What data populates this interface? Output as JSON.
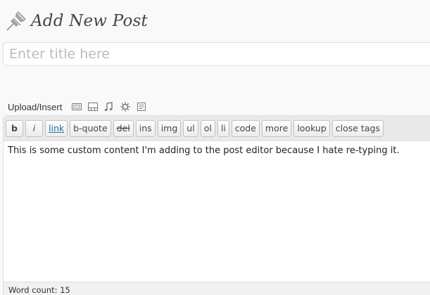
{
  "header": {
    "icon": "pushpin-icon",
    "title": "Add New Post"
  },
  "title_field": {
    "placeholder": "Enter title here",
    "value": ""
  },
  "media": {
    "label": "Upload/Insert",
    "icons": [
      "image-icon",
      "video-icon",
      "audio-icon",
      "media-icon",
      "document-icon"
    ]
  },
  "quicktags": {
    "buttons": [
      "b",
      "i",
      "link",
      "b-quote",
      "del",
      "ins",
      "img",
      "ul",
      "ol",
      "li",
      "code",
      "more",
      "lookup",
      "close tags"
    ]
  },
  "editor": {
    "content": "This is some custom content I'm adding to the post editor because I hate re-typing it."
  },
  "status": {
    "word_count_label": "Word count: 15"
  }
}
